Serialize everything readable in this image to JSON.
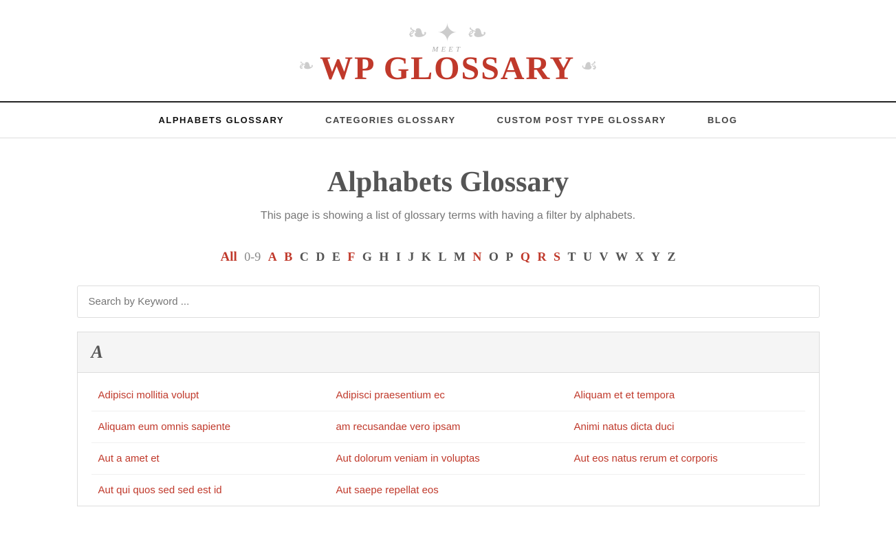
{
  "site": {
    "logo_meet": "MEET",
    "logo_title": "WP GLOSSARY"
  },
  "nav": {
    "items": [
      {
        "id": "alphabets-glossary",
        "label": "ALPHABETS GLOSSARY",
        "active": true
      },
      {
        "id": "categories-glossary",
        "label": "CATEGORIES GLOSSARY",
        "active": false
      },
      {
        "id": "custom-post-type-glossary",
        "label": "CUSTOM POST TYPE GLOSSARY",
        "active": false
      },
      {
        "id": "blog",
        "label": "BLOG",
        "active": false
      }
    ]
  },
  "page": {
    "title": "Alphabets Glossary",
    "description": "This page is showing a list of glossary terms with having a filter by alphabets."
  },
  "alphabet_filter": {
    "all_label": "All",
    "digits_label": "0-9",
    "letters": [
      "A",
      "B",
      "C",
      "D",
      "E",
      "F",
      "G",
      "H",
      "I",
      "J",
      "K",
      "L",
      "M",
      "N",
      "O",
      "P",
      "Q",
      "R",
      "S",
      "T",
      "U",
      "V",
      "W",
      "X",
      "Y",
      "Z"
    ],
    "active_letters": [
      "A",
      "B",
      "F",
      "N",
      "Q",
      "R",
      "S"
    ],
    "dark_letters": [
      "C",
      "D",
      "E",
      "G",
      "H",
      "I",
      "J",
      "K",
      "L",
      "M",
      "O",
      "P",
      "T",
      "U",
      "V",
      "W",
      "X",
      "Y",
      "Z"
    ]
  },
  "search": {
    "placeholder": "Search by Keyword ..."
  },
  "glossary_sections": [
    {
      "letter": "A",
      "terms": [
        "Adipisci mollitia volupt",
        "Adipisci praesentium ec",
        "Aliquam et et tempora",
        "Aliquam eum omnis sapiente",
        "am recusandae vero ipsam",
        "Animi natus dicta duci",
        "Aut a amet et",
        "Aut dolorum veniam in voluptas",
        "Aut eos natus rerum et corporis",
        "Aut qui quos sed sed est id",
        "Aut saepe repellat eos",
        ""
      ]
    }
  ]
}
